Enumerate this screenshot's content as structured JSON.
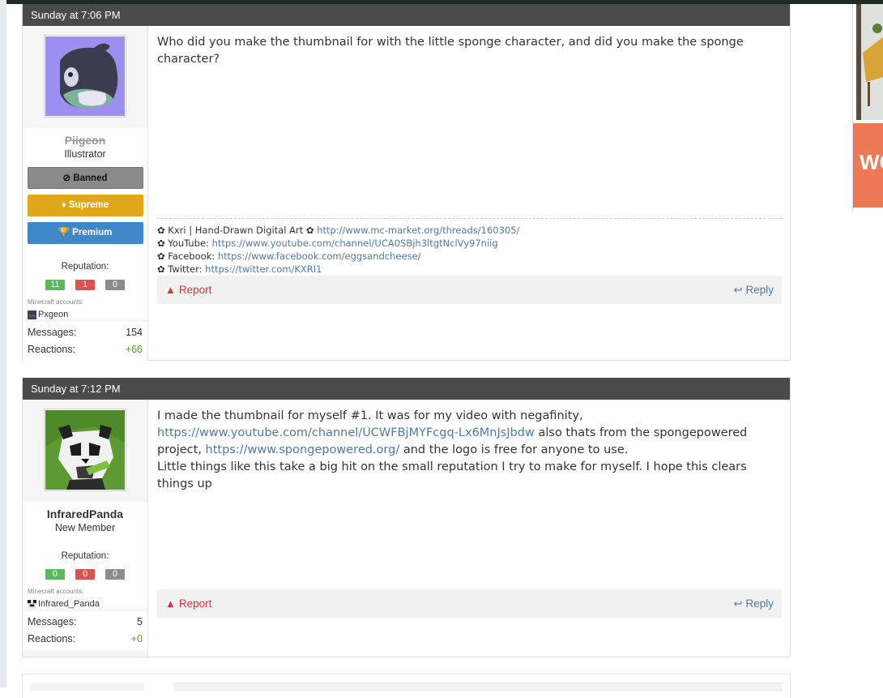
{
  "posts": [
    {
      "timestamp": "Sunday at 7:06 PM",
      "user": {
        "name": "Piigeon",
        "title": "Illustrator",
        "banned": true,
        "badges": {
          "banned": "Banned",
          "supreme": "Supreme",
          "premium": "Premium"
        },
        "reputation_label": "Reputation:",
        "reputation": {
          "positive": "11",
          "negative": "1",
          "neutral": "0"
        },
        "mc_label": "Minecraft accounts:",
        "mc_account": "Pxgeon",
        "stats": [
          {
            "label": "Messages:",
            "value": "154"
          },
          {
            "label": "Reactions:",
            "value": "+66"
          }
        ]
      },
      "message": "Who did you make the thumbnail for with the little sponge character, and did you make the sponge character?",
      "signature": [
        {
          "prefix": "✿ Kxri | Hand-Drawn Digital Art ✿ ",
          "link": "http://www.mc-market.org/threads/160305/"
        },
        {
          "prefix": "✿ YouTube: ",
          "link": "https://www.youtube.com/channel/UCA0SBjh3ltgtNclVy97niig"
        },
        {
          "prefix": "✿ Facebook: ",
          "link": "https://www.facebook.com/eggsandcheese/"
        },
        {
          "prefix": "✿ Twitter: ",
          "link": "https://twitter.com/KXRI1"
        }
      ],
      "actions": {
        "report": "Report",
        "reply": "Reply"
      }
    },
    {
      "timestamp": "Sunday at 7:12 PM",
      "user": {
        "name": "InfraredPanda",
        "title": "New Member",
        "reputation_label": "Reputation:",
        "reputation": {
          "positive": "0",
          "negative": "0",
          "neutral": "0"
        },
        "mc_label": "Minecraft accounts:",
        "mc_account": "Infrared_Panda",
        "stats": [
          {
            "label": "Messages:",
            "value": "5"
          },
          {
            "label": "Reactions:",
            "value": "+0"
          }
        ]
      },
      "message_parts": {
        "p1": "I made the thumbnail for myself #1. It was for my video with negafinity, ",
        "link1": "https://www.youtube.com/channel/UCWFBjMYFcgq-Lx6MnJsJbdw",
        "p2": " also thats from the spongepowered project, ",
        "link2": "https://www.spongepowered.org/",
        "p3": " and the logo is free for anyone to use.",
        "p4": "Little things like this take a big hit on the small reputation I try to make for myself. I hope this clears things up"
      },
      "actions": {
        "report": "Report",
        "reply": "Reply"
      }
    }
  ],
  "side_ad": {
    "text": "WO"
  },
  "colors": {
    "header_bg": "#4a4a4a",
    "link": "#4f7aa4",
    "report": "#d23a3a",
    "supreme": "#e0a71b",
    "premium": "#3f87c7",
    "banned": "#8a8a8a"
  }
}
